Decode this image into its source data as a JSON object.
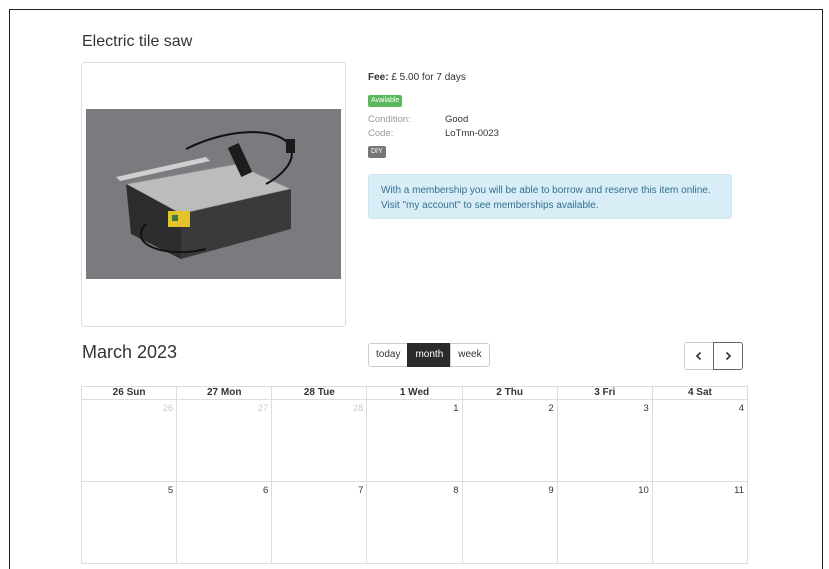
{
  "item": {
    "title": "Electric tile saw",
    "fee_label": "Fee:",
    "fee_value": " £ 5.00 for 7 days",
    "status_badge": "Available",
    "condition_label": "Condition:",
    "condition_value": "Good",
    "code_label": "Code:",
    "code_value": "LoTmn-0023",
    "category_badge": "DIY",
    "membership_notice": "With a membership you will be able to borrow and reserve this item online. Visit \"my account\" to see memberships available."
  },
  "calendar": {
    "title": "March 2023",
    "views": [
      {
        "label": "today",
        "active": false
      },
      {
        "label": "month",
        "active": true
      },
      {
        "label": "week",
        "active": false
      }
    ],
    "prev_icon": "chevron-left-icon",
    "next_icon": "chevron-right-icon",
    "day_headers": [
      "26 Sun",
      "27 Mon",
      "28 Tue",
      "1 Wed",
      "2 Thu",
      "3 Fri",
      "4 Sat"
    ],
    "weeks": [
      [
        {
          "n": "26",
          "other": true
        },
        {
          "n": "27",
          "other": true
        },
        {
          "n": "28",
          "other": true
        },
        {
          "n": "1",
          "other": false
        },
        {
          "n": "2",
          "other": false
        },
        {
          "n": "3",
          "other": false
        },
        {
          "n": "4",
          "other": false
        }
      ],
      [
        {
          "n": "5",
          "other": false
        },
        {
          "n": "6",
          "other": false
        },
        {
          "n": "7",
          "other": false
        },
        {
          "n": "8",
          "other": false
        },
        {
          "n": "9",
          "other": false
        },
        {
          "n": "10",
          "other": false
        },
        {
          "n": "11",
          "other": false
        }
      ]
    ]
  },
  "colors": {
    "available_badge": "#5cb85c",
    "category_badge": "#777777",
    "alert_bg": "#d9edf7",
    "alert_text": "#31708f",
    "active_view": "#2b2b2b"
  }
}
